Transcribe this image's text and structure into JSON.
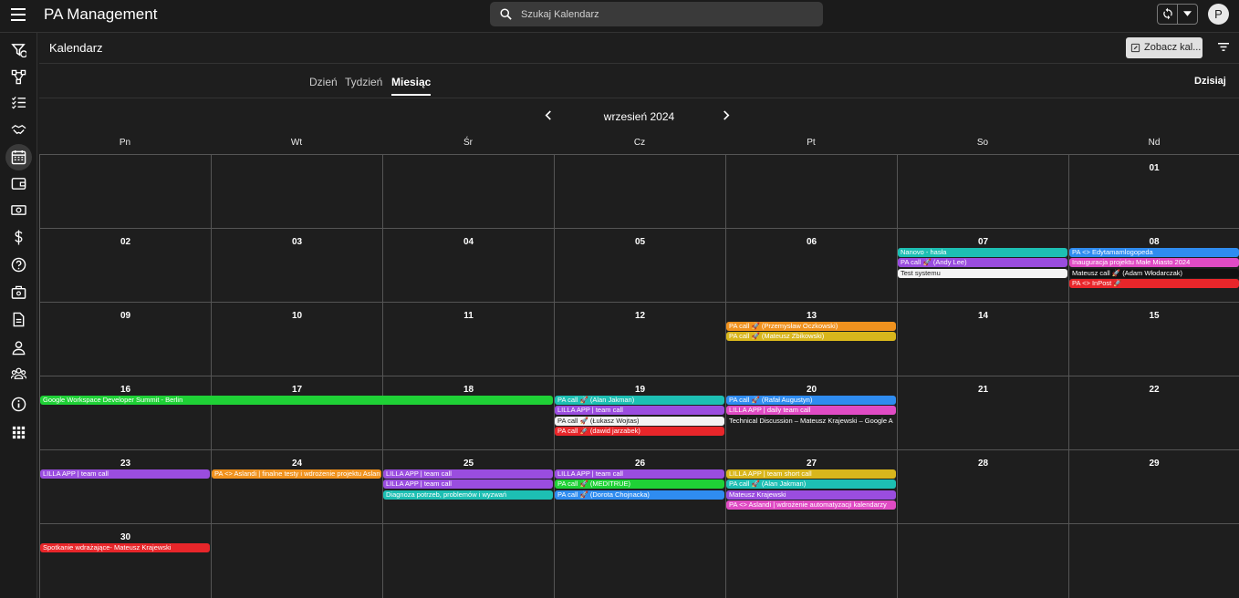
{
  "topbar": {
    "app_title": "PA Management",
    "search_placeholder": "Szukaj Kalendarz",
    "avatar_letter": "P"
  },
  "sidebar": {
    "items": [
      "filter-dollar-icon",
      "workflow-icon",
      "checklist-icon",
      "handshake-icon",
      "calendar-icon",
      "wallet-icon",
      "cash-icon",
      "dollar-icon",
      "help-icon",
      "toolbox-icon",
      "document-icon",
      "person-icon",
      "group-icon",
      "info-icon",
      "apps-icon"
    ],
    "active_index": 4
  },
  "header": {
    "title": "Kalendarz",
    "view_button": "Zobacz kal..."
  },
  "views": {
    "tabs": [
      "Dzień",
      "Tydzień",
      "Miesiąc"
    ],
    "active": 2,
    "today": "Dzisiaj"
  },
  "month": {
    "label": "wrzesień 2024"
  },
  "weekdays": [
    "Pn",
    "Wt",
    "Śr",
    "Cz",
    "Pt",
    "So",
    "Nd"
  ],
  "weeks": [
    [
      null,
      null,
      null,
      null,
      null,
      null,
      "01"
    ],
    [
      "02",
      "03",
      "04",
      "05",
      "06",
      "07",
      "08"
    ],
    [
      "09",
      "10",
      "11",
      "12",
      "13",
      "14",
      "15"
    ],
    [
      "16",
      "17",
      "18",
      "19",
      "20",
      "21",
      "22"
    ],
    [
      "23",
      "24",
      "25",
      "26",
      "27",
      "28",
      "29"
    ],
    [
      "30",
      null,
      null,
      null,
      null,
      null,
      null
    ]
  ],
  "colors": {
    "teal": "#1dbfb3",
    "purple": "#9a4ddf",
    "white": "#f4f4f4",
    "blue": "#2f8cf0",
    "pink": "#e04bc4",
    "black": "#111111",
    "red": "#e8262a",
    "orange": "#f0921e",
    "yellow": "#d8b61c",
    "green": "#1fd136"
  },
  "events": [
    {
      "week": 1,
      "start": 5,
      "span": 1,
      "slot": 0,
      "color": "teal",
      "text": "Nanovo - hasła"
    },
    {
      "week": 1,
      "start": 5,
      "span": 1,
      "slot": 1,
      "color": "purple",
      "text": "PA call 🚀 (Andy Lee)"
    },
    {
      "week": 1,
      "start": 5,
      "span": 1,
      "slot": 2,
      "color": "white",
      "text": "Test systemu"
    },
    {
      "week": 1,
      "start": 6,
      "span": 1,
      "slot": 0,
      "color": "blue",
      "text": "PA <> Edytamamlogopeda"
    },
    {
      "week": 1,
      "start": 6,
      "span": 1,
      "slot": 1,
      "color": "pink",
      "text": "Inauguracja projektu Małe Miasto 2024"
    },
    {
      "week": 1,
      "start": 6,
      "span": 1,
      "slot": 2,
      "color": "black",
      "text": "Mateusz call 🚀 (Adam Włodarczak)"
    },
    {
      "week": 1,
      "start": 6,
      "span": 1,
      "slot": 3,
      "color": "red",
      "text": "PA <> InPost 🚀"
    },
    {
      "week": 2,
      "start": 4,
      "span": 1,
      "slot": 0,
      "color": "orange",
      "text": "PA call 🚀 (Przemysław Oczkowski)"
    },
    {
      "week": 2,
      "start": 4,
      "span": 1,
      "slot": 1,
      "color": "yellow",
      "text": "PA call 🚀 (Mateusz Zbikowski)"
    },
    {
      "week": 3,
      "start": 0,
      "span": 3,
      "slot": 0,
      "color": "green",
      "text": "Google Workspace Developer Summit - Berlin"
    },
    {
      "week": 3,
      "start": 3,
      "span": 1,
      "slot": 0,
      "color": "teal",
      "text": "PA call 🚀 (Alan Jakman)"
    },
    {
      "week": 3,
      "start": 3,
      "span": 1,
      "slot": 1,
      "color": "purple",
      "text": "LILLA APP | team call"
    },
    {
      "week": 3,
      "start": 3,
      "span": 1,
      "slot": 2,
      "color": "white",
      "text": "PA call 🚀 (Łukasz Wojtas)"
    },
    {
      "week": 3,
      "start": 3,
      "span": 1,
      "slot": 3,
      "color": "red",
      "text": "PA call 🚀 (dawid jarzabek)"
    },
    {
      "week": 3,
      "start": 4,
      "span": 1,
      "slot": 0,
      "color": "blue",
      "text": "PA call 🚀 (Rafał Augustyn)"
    },
    {
      "week": 3,
      "start": 4,
      "span": 1,
      "slot": 1,
      "color": "pink",
      "text": "LILLA APP | daily team call"
    },
    {
      "week": 3,
      "start": 4,
      "span": 1,
      "slot": 2,
      "color": "none",
      "text": "Technical Discussion – Mateusz Krajewski – Google A"
    },
    {
      "week": 4,
      "start": 0,
      "span": 1,
      "slot": 0,
      "color": "purple",
      "text": "LILLA APP | team call"
    },
    {
      "week": 4,
      "start": 1,
      "span": 1,
      "slot": 0,
      "color": "orange",
      "text": "PA <> Aslandi | finalne testy i wdrożenie projektu Aslan"
    },
    {
      "week": 4,
      "start": 2,
      "span": 1,
      "slot": 0,
      "color": "purple",
      "text": "LILLA APP | team call"
    },
    {
      "week": 4,
      "start": 2,
      "span": 1,
      "slot": 1,
      "color": "purple",
      "text": "LILLA APP | team call"
    },
    {
      "week": 4,
      "start": 2,
      "span": 1,
      "slot": 2,
      "color": "teal",
      "text": "Diagnoza potrzeb, problemów i wyzwań"
    },
    {
      "week": 4,
      "start": 3,
      "span": 1,
      "slot": 0,
      "color": "purple",
      "text": "LILLA APP | team call"
    },
    {
      "week": 4,
      "start": 3,
      "span": 1,
      "slot": 1,
      "color": "green",
      "text": "PA call 🚀 (MEDITRUE)"
    },
    {
      "week": 4,
      "start": 3,
      "span": 1,
      "slot": 2,
      "color": "blue",
      "text": "PA call 🚀 (Dorota Chojnacka)"
    },
    {
      "week": 4,
      "start": 4,
      "span": 1,
      "slot": 0,
      "color": "yellow",
      "text": "LILLA APP | team short call"
    },
    {
      "week": 4,
      "start": 4,
      "span": 1,
      "slot": 1,
      "color": "teal",
      "text": "PA call 🚀 (Alan Jakman)"
    },
    {
      "week": 4,
      "start": 4,
      "span": 1,
      "slot": 2,
      "color": "purple",
      "text": "Mateusz Krajewski"
    },
    {
      "week": 4,
      "start": 4,
      "span": 1,
      "slot": 3,
      "color": "pink",
      "text": "PA <> Aslandi | wdrożenie automatyzacji kalendarzy"
    },
    {
      "week": 5,
      "start": 0,
      "span": 1,
      "slot": 0,
      "color": "red",
      "text": "Spotkanie wdrażające- Mateusz Krajewski"
    }
  ]
}
